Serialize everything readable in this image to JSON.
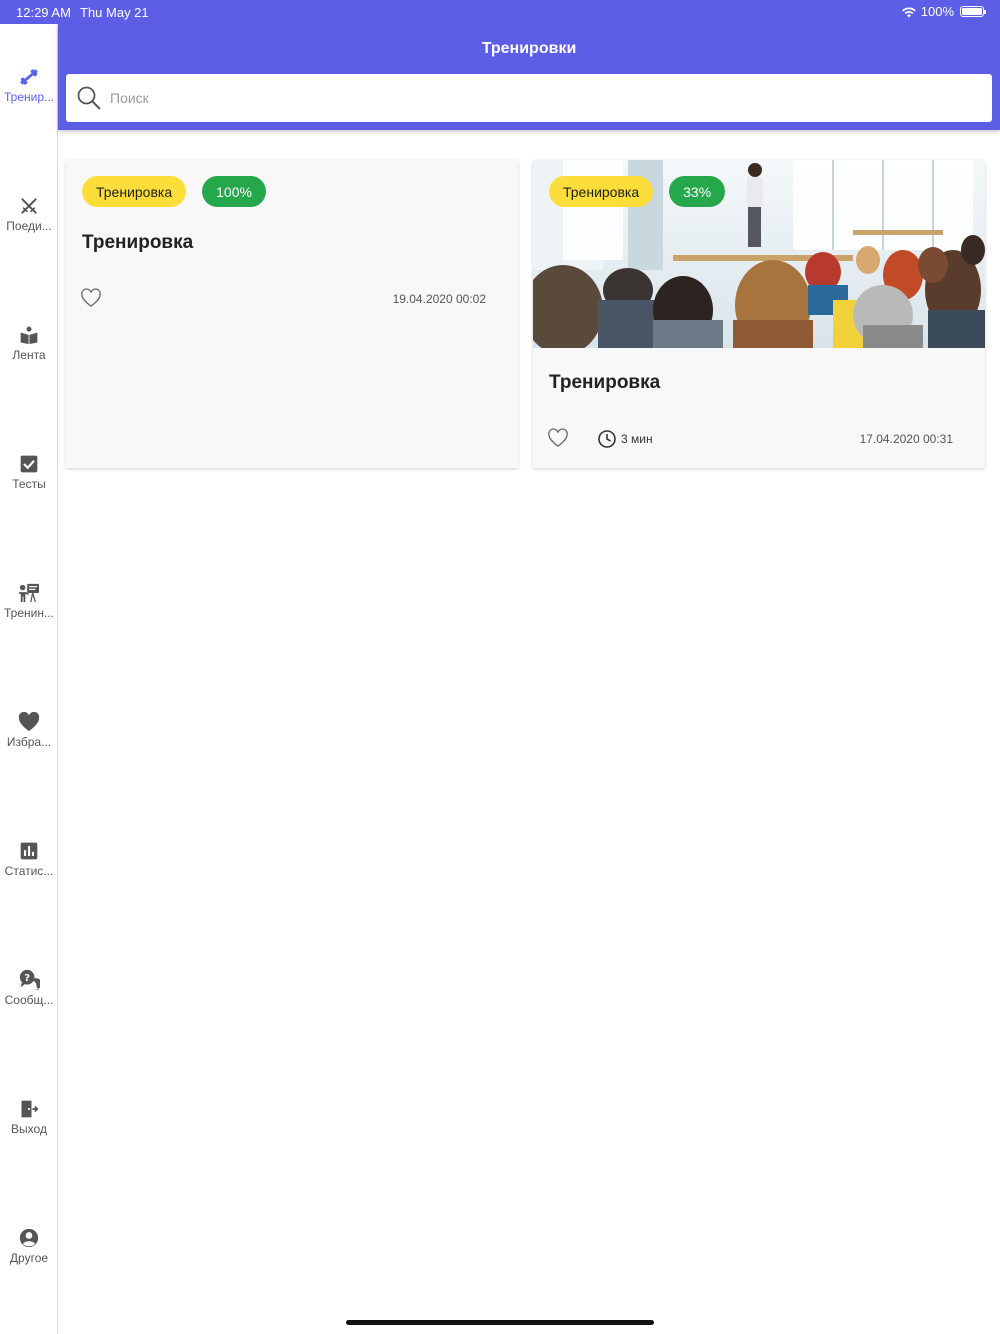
{
  "status_bar": {
    "time": "12:29 AM",
    "date": "Thu May 21",
    "battery": "100%"
  },
  "header": {
    "title": "Тренировки"
  },
  "search": {
    "placeholder": "Поиск"
  },
  "sidebar": {
    "items": [
      {
        "label": "Тренир...",
        "icon": "dumbbell-icon",
        "active": true
      },
      {
        "label": "Поеди...",
        "icon": "swords-icon"
      },
      {
        "label": "Лента",
        "icon": "reading-icon"
      },
      {
        "label": "Тесты",
        "icon": "checkbox-icon"
      },
      {
        "label": "Тренин...",
        "icon": "presentation-icon"
      },
      {
        "label": "Избра...",
        "icon": "heart-icon"
      },
      {
        "label": "Статис...",
        "icon": "bar-chart-icon"
      },
      {
        "label": "Сообщ...",
        "icon": "chat-question-icon"
      },
      {
        "label": "Выход",
        "icon": "exit-icon"
      },
      {
        "label": "Другое",
        "icon": "account-icon"
      }
    ]
  },
  "cards": [
    {
      "badge_type": "Тренировка",
      "badge_progress": "100%",
      "title": "Тренировка",
      "date": "19.04.2020 00:02",
      "progress": 1.0
    },
    {
      "badge_type": "Тренировка",
      "badge_progress": "33%",
      "title": "Тренировка",
      "duration": "3 мин",
      "date": "17.04.2020 00:31",
      "progress": 0.33
    }
  ],
  "colors": {
    "primary": "#5c5fe6",
    "badge_yellow": "#fddd3a",
    "badge_green": "#25a84b"
  }
}
